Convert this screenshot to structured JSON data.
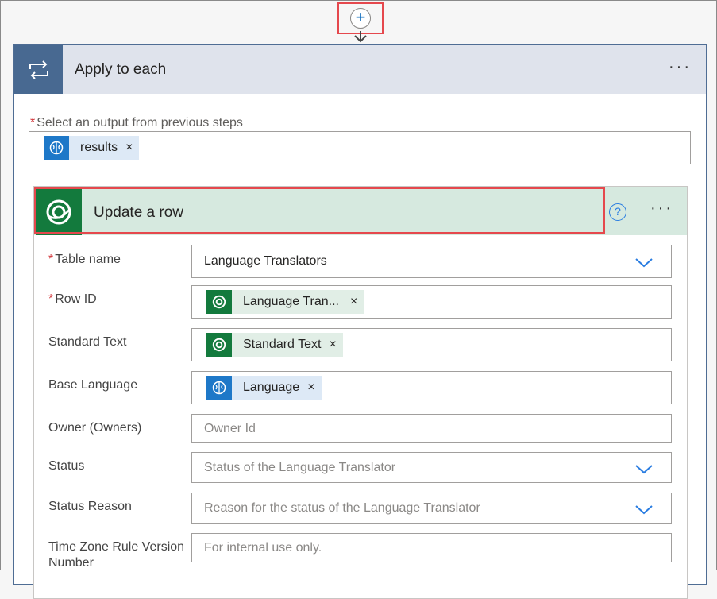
{
  "add_step": {
    "symbol": "+"
  },
  "apply": {
    "title": "Apply to each",
    "more": "···",
    "select_required": "*",
    "select_label": "Select an output from previous steps",
    "token": {
      "label": "results",
      "remove": "×",
      "icon": "brain-icon"
    }
  },
  "update": {
    "title": "Update a row",
    "help": "?",
    "more": "···",
    "fields": {
      "table_name": {
        "required": "*",
        "label": "Table name",
        "value": "Language Translators"
      },
      "row_id": {
        "required": "*",
        "label": "Row ID",
        "token": "Language Tran...",
        "remove": "×"
      },
      "standard_text": {
        "label": "Standard Text",
        "token": "Standard Text",
        "remove": "×"
      },
      "base_language": {
        "label": "Base Language",
        "token": "Language",
        "remove": "×"
      },
      "owner": {
        "label": "Owner (Owners)",
        "placeholder": "Owner Id"
      },
      "status": {
        "label": "Status",
        "placeholder": "Status of the Language Translator"
      },
      "status_reason": {
        "label": "Status Reason",
        "placeholder": "Reason for the status of the Language Translator"
      },
      "time_zone": {
        "label": "Time Zone Rule Version Number",
        "placeholder": "For internal use only."
      }
    }
  },
  "colors": {
    "apply_accent": "#486991",
    "dataverse_green": "#137a3d",
    "highlight_red": "#e5484d",
    "link_blue": "#2a7de1"
  }
}
